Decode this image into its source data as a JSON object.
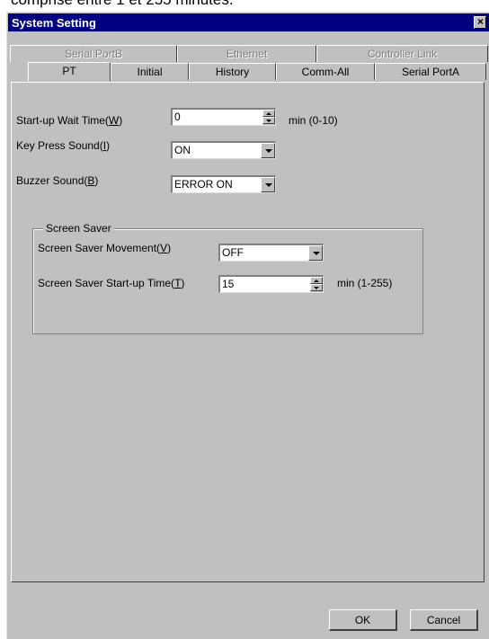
{
  "page_caption": "comprise entre 1 et 255 minutes.",
  "window": {
    "title": "System Setting",
    "close_glyph": "×"
  },
  "tabs_back": [
    {
      "label": "Serial PortB",
      "enabled": false
    },
    {
      "label": "Ethernet",
      "enabled": false
    },
    {
      "label": "Controller Link",
      "enabled": false
    }
  ],
  "tabs_front": [
    {
      "label": "PT",
      "active": true
    },
    {
      "label": "Initial",
      "active": false
    },
    {
      "label": "History",
      "active": false
    },
    {
      "label": "Comm-All",
      "active": false
    },
    {
      "label": "Serial PortA",
      "active": false
    }
  ],
  "startup_wait": {
    "label": "Start-up Wait Time(",
    "accel": "W",
    "label_end": ")",
    "value": "0",
    "unit": "min (0-10)"
  },
  "key_press": {
    "label": "Key Press Sound(",
    "accel": "I",
    "label_end": ")",
    "value": "ON"
  },
  "buzzer": {
    "label": "Buzzer Sound(",
    "accel": "B",
    "label_end": ")",
    "value": "ERROR ON"
  },
  "screen_saver": {
    "group_title": "Screen Saver",
    "movement": {
      "label": "Screen Saver Movement(",
      "accel": "V",
      "label_end": ")",
      "value": "OFF"
    },
    "start_time": {
      "label": "Screen Saver Start-up Time(",
      "accel": "T",
      "label_end": ")",
      "value": "15",
      "unit": "min (1-255)"
    }
  },
  "buttons": {
    "ok": "OK",
    "cancel": "Cancel"
  },
  "icons": {
    "close": "close-icon",
    "spin_up": "arrow-up-icon",
    "spin_down": "arrow-down-icon",
    "combo": "chevron-down-icon"
  }
}
